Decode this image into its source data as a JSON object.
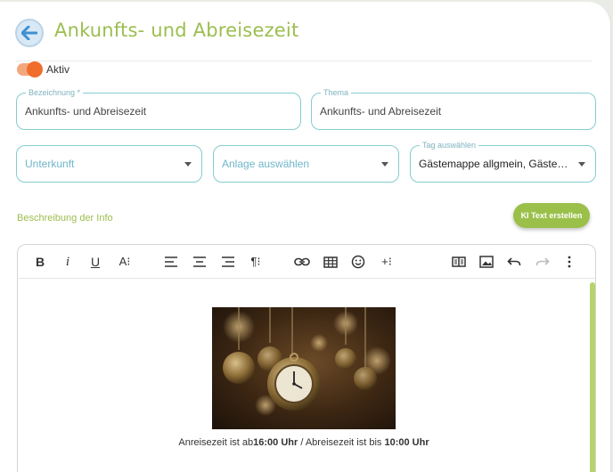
{
  "header": {
    "title": "Ankunfts- und Abreisezeit"
  },
  "toggle": {
    "label": "Aktiv",
    "on": true
  },
  "fields": {
    "bezeichnung": {
      "label": "Bezeichnung *",
      "value": "Ankunfts- und Abreisezeit"
    },
    "thema": {
      "label": "Thema",
      "value": "Ankunfts- und Abreisezeit"
    },
    "unterkunft": {
      "placeholder": "Unterkunft"
    },
    "anlage": {
      "placeholder": "Anlage auswählen"
    },
    "tag": {
      "label": "Tag auswählen",
      "value": "Gästemappe allgmein, Gästemap..."
    }
  },
  "section": {
    "label": "Beschreibung der Info"
  },
  "ki_button": {
    "label": "KI Text erstellen"
  },
  "toolbar": {
    "bold": "B",
    "italic": "i",
    "underline": "U",
    "font_size": "A⁝",
    "paragraph": "¶⁝",
    "insert_more": "+⁝"
  },
  "content": {
    "caption_1": "Anreisezeit ist ab",
    "time_1": "16:00 Uhr",
    "caption_2": " / Abreisezeit ist bis ",
    "time_2": "10:00 Uhr"
  },
  "colors": {
    "accent": "#9bbe4f",
    "toggle": "#f06d2b",
    "field_border": "#84cdcf"
  }
}
